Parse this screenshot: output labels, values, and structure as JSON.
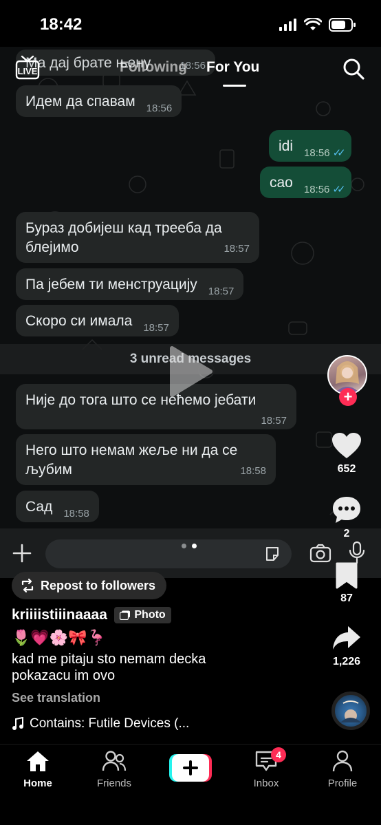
{
  "status_bar": {
    "time": "18:42"
  },
  "top_nav": {
    "tab_following": "Following",
    "tab_for_you": "For You"
  },
  "chat": {
    "messages": [
      {
        "text": "Ма дај брате њену",
        "time": "18:56",
        "dir": "in"
      },
      {
        "text": "Идем да спавам",
        "time": "18:56",
        "dir": "in"
      },
      {
        "text": "idi",
        "time": "18:56",
        "dir": "out"
      },
      {
        "text": "сао",
        "time": "18:56",
        "dir": "out"
      },
      {
        "text": "Бураз добијеш кад трееба да блејимо",
        "time": "18:57",
        "dir": "in"
      },
      {
        "text": "Па јебем  ти менструацију",
        "time": "18:57",
        "dir": "in"
      },
      {
        "text": "Скоро си имала",
        "time": "18:57",
        "dir": "in"
      },
      {
        "text": "Није до тога што се нећемо јебати",
        "time": "18:57",
        "dir": "in"
      },
      {
        "text": "Него што немам жеље ни да се љубим",
        "time": "18:58",
        "dir": "in"
      },
      {
        "text": "Сад",
        "time": "18:58",
        "dir": "in"
      }
    ],
    "unread_label": "3 unread messages"
  },
  "rail": {
    "likes": "652",
    "comments": "2",
    "saves": "87",
    "shares": "1,226"
  },
  "post": {
    "repost_label": "Repost to followers",
    "username": "kriiiistiiinaaaa",
    "badge": "Photo",
    "emojis": "🌷💗🌸🎀🦩",
    "caption": "kad me pitaju sto nemam decka pokazacu im ovo",
    "see_translation": "See translation",
    "music": "Contains: Futile Devices (..."
  },
  "bottom_nav": {
    "home": "Home",
    "friends": "Friends",
    "inbox": "Inbox",
    "inbox_badge": "4",
    "profile": "Profile"
  },
  "colors": {
    "accent": "#fe2c55",
    "outgoing_bubble": "#144d37",
    "incoming_bubble": "#232626",
    "read_ticks": "#53bdeb"
  }
}
